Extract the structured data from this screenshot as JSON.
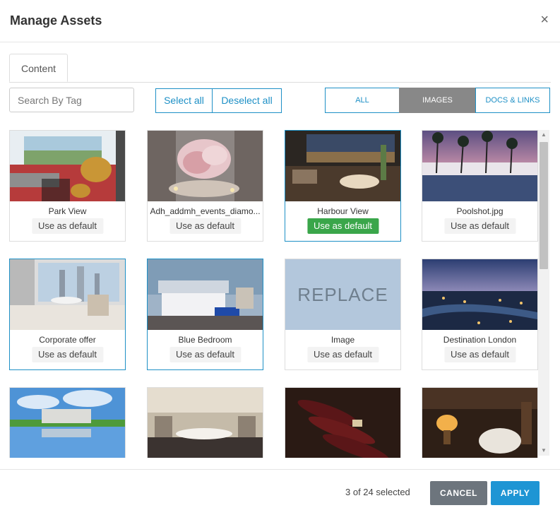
{
  "dialog": {
    "title": "Manage Assets",
    "close_glyph": "×"
  },
  "tabs": [
    {
      "label": "Content"
    }
  ],
  "search": {
    "placeholder": "Search By Tag",
    "value": ""
  },
  "selection": {
    "select_all": "Select all",
    "deselect_all": "Deselect all"
  },
  "filters": {
    "all": "ALL",
    "images": "IMAGES",
    "docs_links": "DOCS & LINKS",
    "active": "IMAGES"
  },
  "assets": [
    {
      "caption": "Park View",
      "button": "Use as default",
      "selected": false,
      "is_default": false
    },
    {
      "caption": "Adh_addmh_events_diamo...",
      "button": "Use as default",
      "selected": false,
      "is_default": false
    },
    {
      "caption": "Harbour View",
      "button": "Use as default",
      "selected": true,
      "is_default": true
    },
    {
      "caption": "Poolshot.jpg",
      "button": "Use as default",
      "selected": false,
      "is_default": false
    },
    {
      "caption": "Corporate offer",
      "button": "Use as default",
      "selected": true,
      "is_default": false
    },
    {
      "caption": "Blue Bedroom",
      "button": "Use as default",
      "selected": true,
      "is_default": false
    },
    {
      "caption": "Image",
      "button": "Use as default",
      "selected": false,
      "is_default": false,
      "thumb_text": "REPLACE"
    },
    {
      "caption": "Destination London",
      "button": "Use as default",
      "selected": false,
      "is_default": false
    },
    {
      "caption": "",
      "button": "",
      "selected": false
    },
    {
      "caption": "",
      "button": "",
      "selected": false
    },
    {
      "caption": "",
      "button": "",
      "selected": false
    },
    {
      "caption": "",
      "button": "",
      "selected": false
    }
  ],
  "footer": {
    "count_text": "3 of 24 selected",
    "cancel": "CANCEL",
    "apply": "APPLY"
  },
  "colors": {
    "accent": "#1e90c6",
    "default_green": "#3aa64a",
    "active_filter": "#888888",
    "cancel": "#6d757d",
    "apply": "#1e95d4"
  },
  "icons": {
    "close": "close-icon",
    "scroll_up": "scroll-up-arrow-icon",
    "scroll_down": "scroll-down-arrow-icon"
  }
}
